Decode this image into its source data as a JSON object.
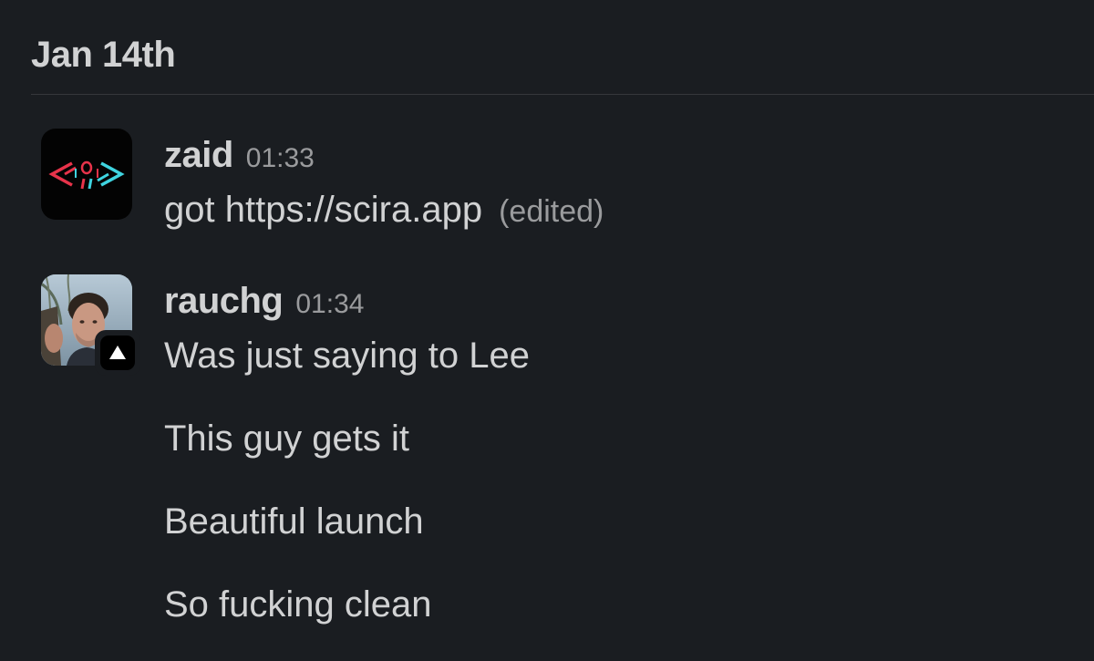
{
  "date_header": "Jan 14th",
  "messages": [
    {
      "author": "zaid",
      "time": "01:33",
      "lines": [
        "got https://scira.app"
      ],
      "edited_label": "(edited)",
      "avatar_icon": "scira-logo-icon"
    },
    {
      "author": "rauchg",
      "time": "01:34",
      "lines": [
        "Was just saying to Lee",
        "This guy gets it",
        "Beautiful launch",
        "So fucking clean"
      ],
      "avatar_icon": "user-photo",
      "badge_icon": "vercel-triangle-icon"
    }
  ],
  "colors": {
    "background": "#1a1d21",
    "text": "#d1d2d3",
    "muted": "#9a9b9d",
    "divider": "#35373b",
    "logo_red": "#e8334a",
    "logo_cyan": "#3fd4e0"
  }
}
